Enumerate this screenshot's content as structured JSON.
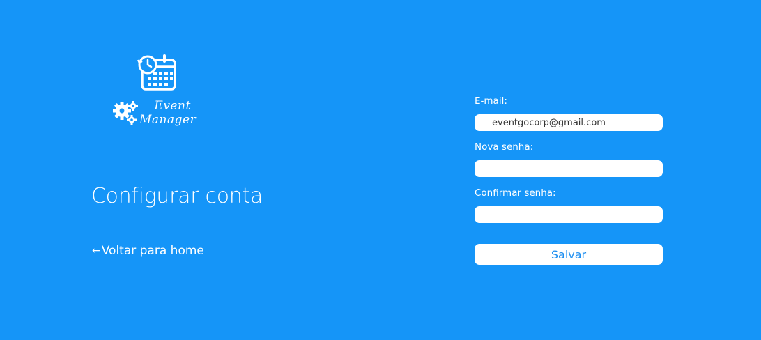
{
  "logo": {
    "line1": "Event",
    "line2": "Manager"
  },
  "page_title": "Configurar conta",
  "back_link": {
    "arrow": "←",
    "label": "Voltar para home"
  },
  "form": {
    "email": {
      "label": "E-mail:",
      "value": "eventgocorp@gmail.com"
    },
    "new_password": {
      "label": "Nova senha:",
      "value": ""
    },
    "confirm_password": {
      "label": "Confirmar senha:",
      "value": ""
    },
    "save_label": "Salvar"
  },
  "colors": {
    "background": "#1595f8",
    "button_text": "#1f8ff0",
    "surface": "#ffffff"
  }
}
